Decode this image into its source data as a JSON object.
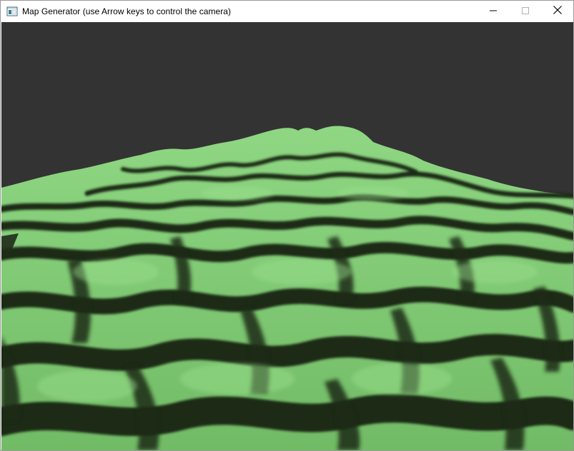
{
  "window": {
    "title": "Map Generator (use Arrow keys to control the camera)",
    "icon": "app-window-icon",
    "controls": [
      "minimize-icon",
      "maximize-icon",
      "close-icon"
    ]
  },
  "viewport": {
    "background_color": "#333333",
    "terrain_color": "#76c46a",
    "terrain_highlight_color": "#8fd783",
    "shadow_color": "#1f2c19"
  }
}
